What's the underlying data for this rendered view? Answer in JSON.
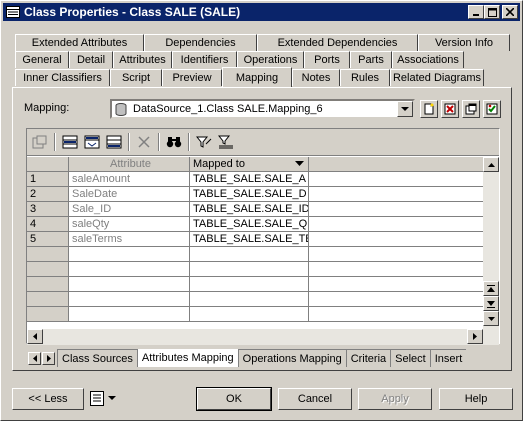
{
  "window": {
    "title": "Class Properties - Class SALE (SALE)"
  },
  "tabs": {
    "row1": [
      "Extended Attributes",
      "Dependencies",
      "Extended Dependencies",
      "Version Info"
    ],
    "row2": [
      "General",
      "Detail",
      "Attributes",
      "Identifiers",
      "Operations",
      "Ports",
      "Parts",
      "Associations"
    ],
    "row3": [
      "Inner Classifiers",
      "Script",
      "Preview",
      "Mapping",
      "Notes",
      "Rules",
      "Related Diagrams"
    ],
    "active": "Mapping"
  },
  "mapping": {
    "label": "Mapping:",
    "value": "DataSource_1.Class SALE.Mapping_6"
  },
  "grid": {
    "columns": [
      "Attribute",
      "Mapped to"
    ],
    "rows": [
      {
        "num": "1",
        "attribute": "saleAmount",
        "mapped": "TABLE_SALE.SALE_A"
      },
      {
        "num": "2",
        "attribute": "SaleDate",
        "mapped": "TABLE_SALE.SALE_D"
      },
      {
        "num": "3",
        "attribute": "Sale_ID",
        "mapped": "TABLE_SALE.SALE_ID"
      },
      {
        "num": "4",
        "attribute": "saleQty",
        "mapped": "TABLE_SALE.SALE_Q"
      },
      {
        "num": "5",
        "attribute": "saleTerms",
        "mapped": "TABLE_SALE.SALE_TE"
      }
    ]
  },
  "bottom_tabs": [
    "Class Sources",
    "Attributes Mapping",
    "Operations Mapping",
    "Criteria",
    "Select",
    "Insert"
  ],
  "bottom_tabs_active": "Attributes Mapping",
  "buttons": {
    "less": "<< Less",
    "ok": "OK",
    "cancel": "Cancel",
    "apply": "Apply",
    "help": "Help"
  }
}
